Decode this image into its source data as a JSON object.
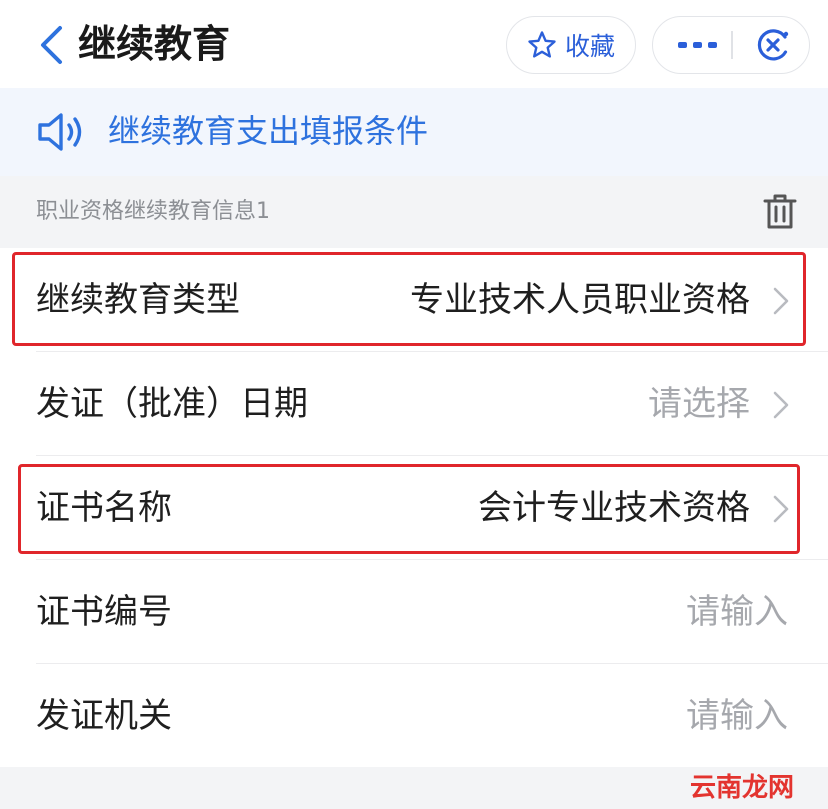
{
  "header": {
    "title": "继续教育",
    "favorite_label": "收藏"
  },
  "notice": {
    "text": "继续教育支出填报条件"
  },
  "section": {
    "title": "职业资格继续教育信息1"
  },
  "form": {
    "rows": [
      {
        "label": "继续教育类型",
        "value": "专业技术人员职业资格",
        "filled": true,
        "has_chevron": true,
        "highlighted": true
      },
      {
        "label": "发证（批准）日期",
        "value": "请选择",
        "filled": false,
        "has_chevron": true,
        "highlighted": false
      },
      {
        "label": "证书名称",
        "value": "会计专业技术资格",
        "filled": true,
        "has_chevron": true,
        "highlighted": true
      },
      {
        "label": "证书编号",
        "value": "请输入",
        "filled": false,
        "has_chevron": false,
        "highlighted": false
      },
      {
        "label": "发证机关",
        "value": "请输入",
        "filled": false,
        "has_chevron": false,
        "highlighted": false
      }
    ]
  },
  "footer": {
    "watermark": "云南龙网"
  },
  "colors": {
    "accent": "#2e72de",
    "highlight": "#e0262b",
    "placeholder": "#a6a8ad",
    "text": "#1f1f1f"
  },
  "icons": {
    "back": "chevron-left-icon",
    "favorite": "star-icon",
    "more": "more-dots-icon",
    "close": "close-circle-icon",
    "notice": "speaker-icon",
    "delete": "trash-icon",
    "row_arrow": "chevron-right-icon"
  }
}
